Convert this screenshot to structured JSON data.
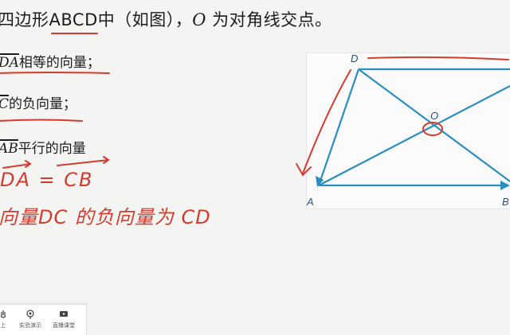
{
  "title": {
    "part1": "四边形",
    "abcd": "ABCD",
    "part2": "中（如图），",
    "o": "O",
    "part3": " 为对角线交点。"
  },
  "items": [
    {
      "vector": "DA",
      "text": "相等的向量；"
    },
    {
      "vector": "C",
      "text": "的负向量；"
    },
    {
      "vector": "AB",
      "text": "平行的向量"
    }
  ],
  "handwriting": {
    "line1": "DA = CB",
    "line2": "向量DC 的负向量为 CD"
  },
  "diagram": {
    "labels": {
      "A": "A",
      "B": "B",
      "D": "D",
      "O": "O"
    },
    "line_color": "#2a8fc0",
    "ink_color": "#d53b2e"
  },
  "toolbar": {
    "items": [
      {
        "label": "上",
        "icon": "hand-icon"
      },
      {
        "label": "实验演示",
        "icon": "experiment-icon"
      },
      {
        "label": "直播课堂",
        "icon": "live-class-icon"
      }
    ]
  }
}
